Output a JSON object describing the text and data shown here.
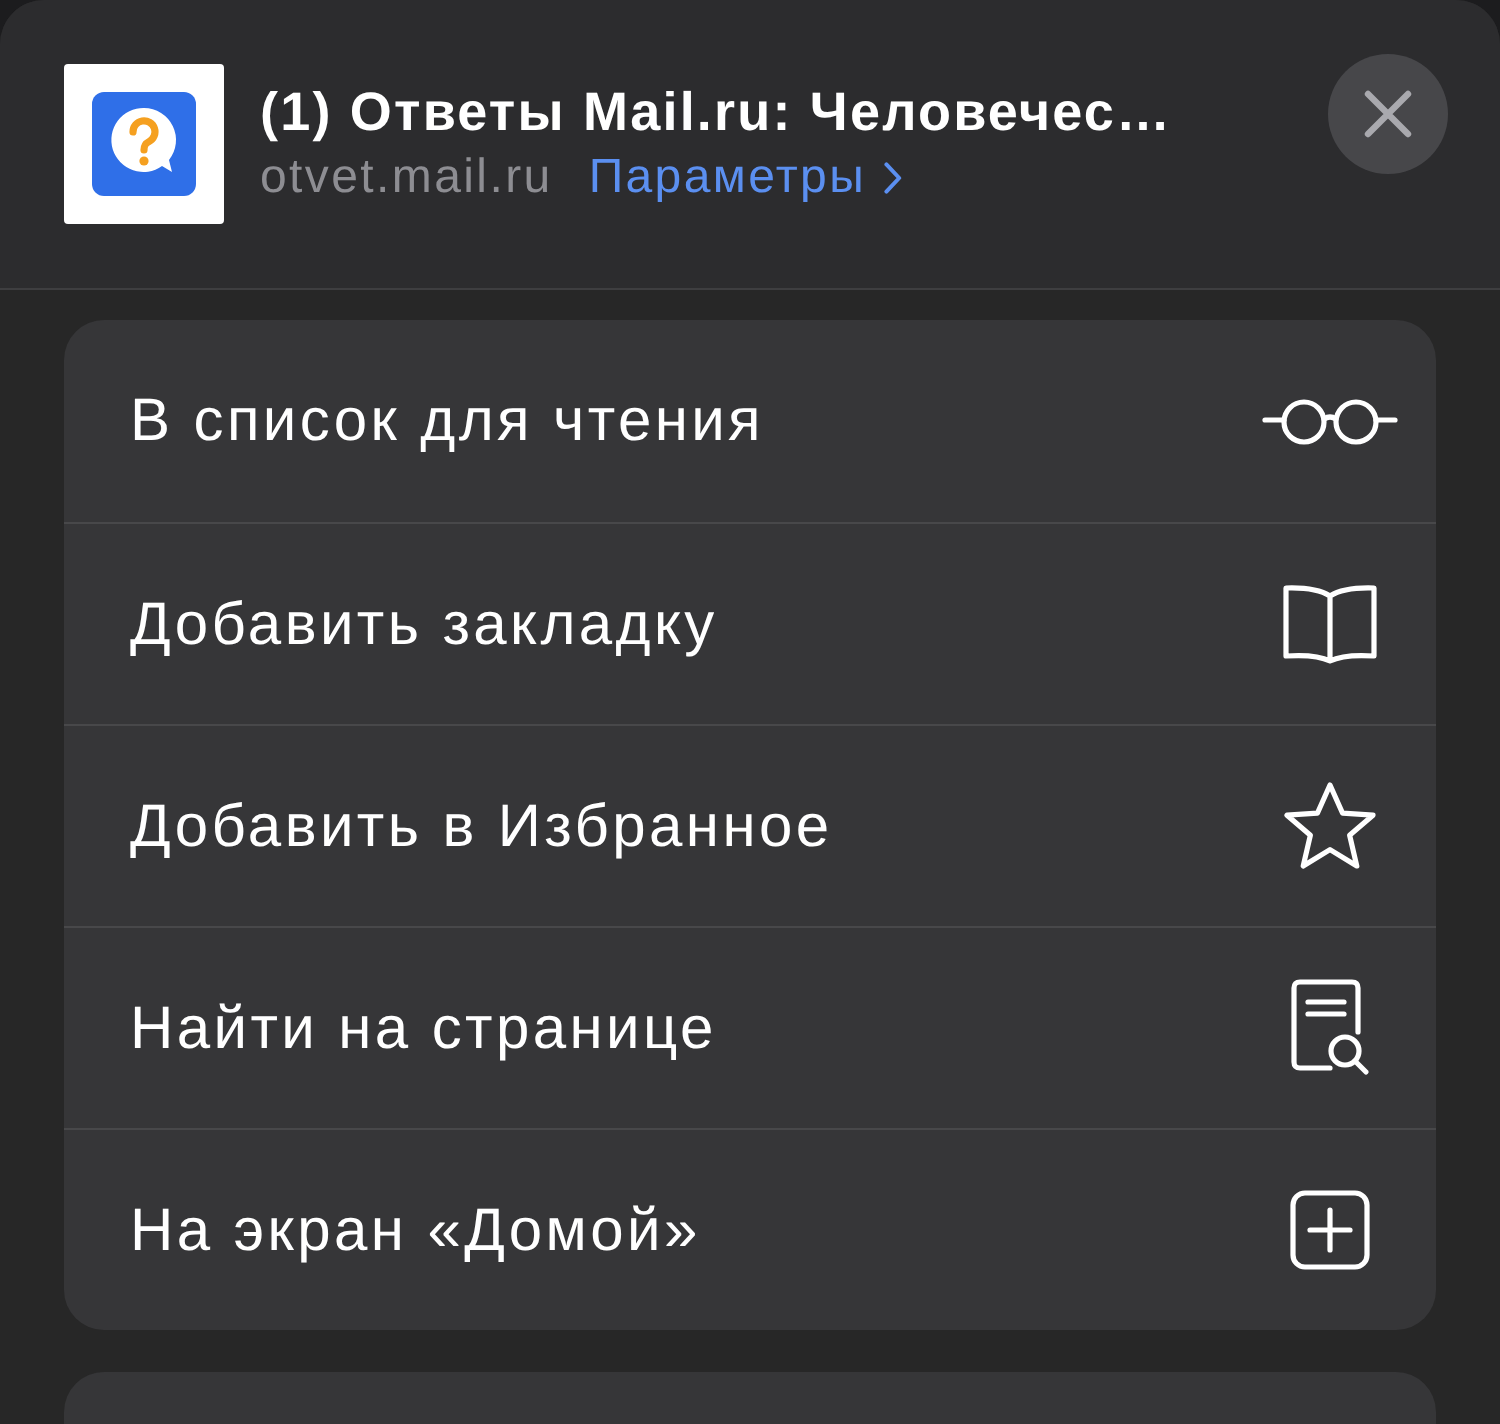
{
  "header": {
    "title": "(1) Ответы Mail.ru: Человечес…",
    "url": "otvet.mail.ru",
    "options_link": "Параметры"
  },
  "actions": [
    {
      "label": "В список для чтения",
      "kind": "reading"
    },
    {
      "label": "Добавить закладку",
      "kind": "bookmark"
    },
    {
      "label": "Добавить в Избранное",
      "kind": "favorite"
    },
    {
      "label": "Найти на странице",
      "kind": "find"
    },
    {
      "label": "На экран «Домой»",
      "kind": "homescreen"
    }
  ]
}
